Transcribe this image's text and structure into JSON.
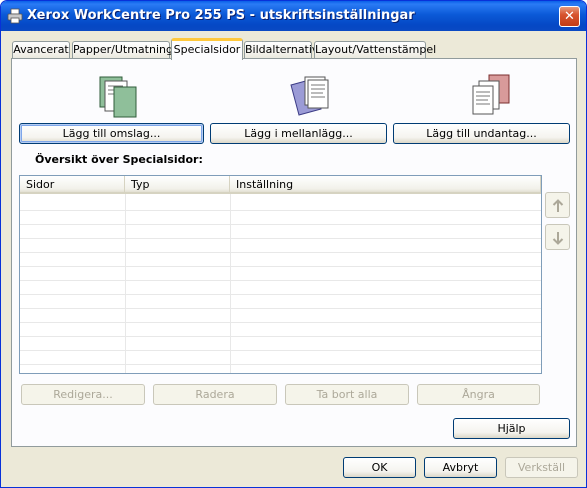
{
  "window": {
    "title": "Xerox WorkCentre Pro 255 PS - utskriftsinställningar",
    "close_glyph": "✕"
  },
  "tabs": [
    {
      "label": "Avancerat",
      "active": false
    },
    {
      "label": "Papper/Utmatning",
      "active": false
    },
    {
      "label": "Specialsidor",
      "active": true
    },
    {
      "label": "Bildalternativ",
      "active": false
    },
    {
      "label": "Layout/Vattenstämpel",
      "active": false
    }
  ],
  "actions": {
    "add_cover_label": "Lägg till omslag...",
    "add_insert_label": "Lägg i mellanlägg...",
    "add_exception_label": "Lägg till undantag..."
  },
  "icons": {
    "cover": "cover-pages-icon",
    "insert": "insert-pages-icon",
    "exception": "exception-pages-icon"
  },
  "overview": {
    "heading": "Översikt över Specialsidor:",
    "columns": [
      "Sidor",
      "Typ",
      "Inställning"
    ],
    "rows": []
  },
  "list_actions": {
    "edit_label": "Redigera...",
    "delete_label": "Radera",
    "delete_all_label": "Ta bort alla",
    "undo_label": "Ångra"
  },
  "help_label": "Hjälp",
  "footer": {
    "ok_label": "OK",
    "cancel_label": "Avbryt",
    "apply_label": "Verkställ"
  }
}
